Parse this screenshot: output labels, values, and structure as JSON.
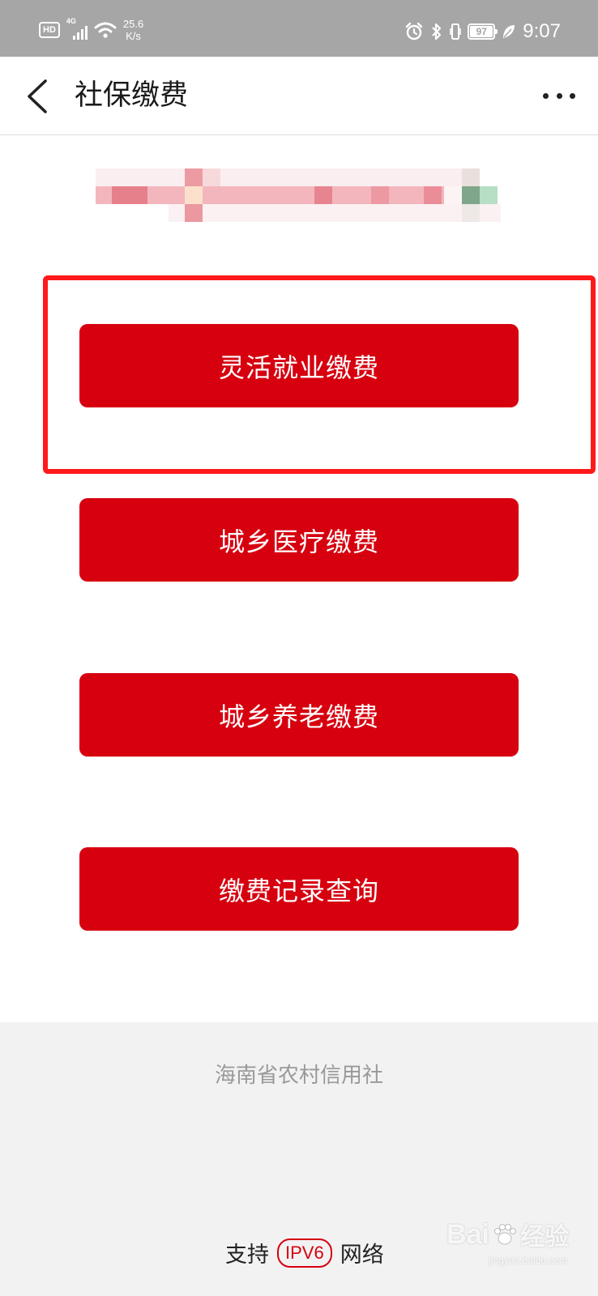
{
  "status_bar": {
    "hd_badge": "HD",
    "network_gen": "4G",
    "speed_value": "25.6",
    "speed_unit": "K/s",
    "battery_level": "97",
    "time": "9:07"
  },
  "nav": {
    "title": "社保缴费",
    "back_icon": "chevron-left-icon",
    "more_icon": "more-dots-icon"
  },
  "buttons": [
    {
      "label": "灵活就业缴费"
    },
    {
      "label": "城乡医疗缴费"
    },
    {
      "label": "城乡养老缴费"
    },
    {
      "label": "缴费记录查询"
    }
  ],
  "footer": {
    "organization": "海南省农村信用社",
    "support_prefix": "支持",
    "ipv6_badge": "IPV6",
    "support_suffix": "网络"
  },
  "watermark": {
    "brand": "Bai",
    "brand_suffix": "经验",
    "url": "jingyan.baidu.com"
  },
  "colors": {
    "accent_red": "#d6000f",
    "highlight_frame": "#ff1a1a",
    "status_bar_bg": "#a6a6a6",
    "footer_bg": "#f2f2f2"
  }
}
